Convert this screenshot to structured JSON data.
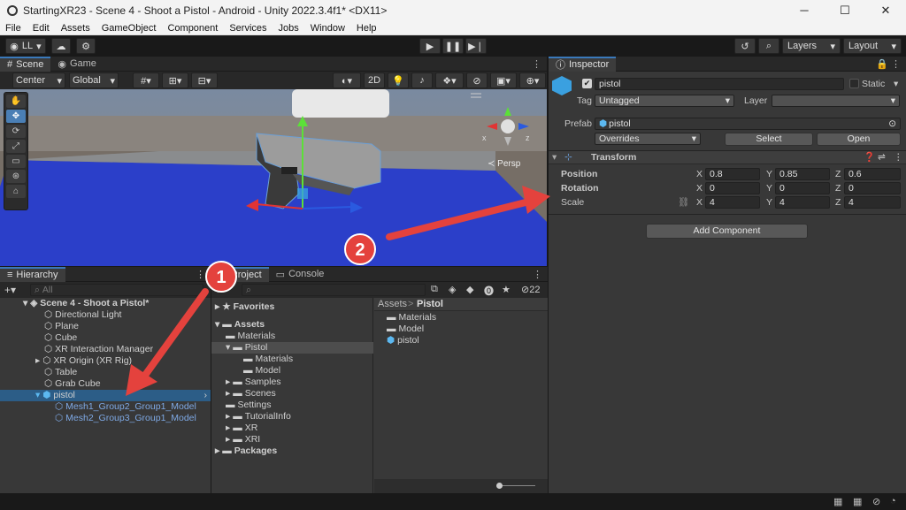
{
  "window": {
    "title": "StartingXR23 - Scene 4 - Shoot a Pistol - Android - Unity 2022.3.4f1* <DX11>",
    "min": "─",
    "max": "☐",
    "close": "✕"
  },
  "menu": [
    "File",
    "Edit",
    "Assets",
    "GameObject",
    "Component",
    "Services",
    "Jobs",
    "Window",
    "Help"
  ],
  "toolbar": {
    "account": "LL",
    "layers": "Layers",
    "layout": "Layout"
  },
  "scene": {
    "tab_scene": "Scene",
    "tab_game": "Game",
    "pivot": "Center",
    "space": "Global",
    "mode2d": "2D",
    "persp": "≺ Persp"
  },
  "hierarchy": {
    "tab": "Hierarchy",
    "search_placeholder": "All",
    "scene_name": "Scene 4 - Shoot a Pistol*",
    "items": [
      "Directional Light",
      "Plane",
      "Cube",
      "XR Interaction Manager",
      "XR Origin (XR Rig)",
      "Table",
      "Grab Cube",
      "pistol",
      "Mesh1_Group2_Group1_Model",
      "Mesh2_Group3_Group1_Model"
    ]
  },
  "project": {
    "tab_project": "Project",
    "tab_console": "Console",
    "hidden_count": "22",
    "favorites": "Favorites",
    "assets": "Assets",
    "tree": [
      "Materials",
      "Pistol",
      "Materials",
      "Model",
      "Samples",
      "Scenes",
      "Settings",
      "TutorialInfo",
      "XR",
      "XRI"
    ],
    "packages": "Packages",
    "breadcrumb_root": "Assets",
    "breadcrumb_sep": ">",
    "breadcrumb_current": "Pistol",
    "files": [
      "Materials",
      "Model",
      "pistol"
    ]
  },
  "inspector": {
    "tab": "Inspector",
    "object_name": "pistol",
    "static_label": "Static",
    "tag_label": "Tag",
    "tag_value": "Untagged",
    "layer_label": "Layer",
    "layer_value": "",
    "prefab_label": "Prefab",
    "prefab_value": "pistol",
    "overrides": "Overrides",
    "select": "Select",
    "open": "Open",
    "transform_title": "Transform",
    "position_label": "Position",
    "rotation_label": "Rotation",
    "scale_label": "Scale",
    "position": {
      "x": "0.8",
      "y": "0.85",
      "z": "0.6"
    },
    "rotation": {
      "x": "0",
      "y": "0",
      "z": "0"
    },
    "scale": {
      "x": "4",
      "y": "4",
      "z": "4"
    },
    "add_component": "Add Component"
  },
  "callouts": [
    "1",
    "2"
  ],
  "colors": {
    "selection": "#2c5d87",
    "callout": "#e4423d",
    "ground": "#2b3fc9",
    "accent": "#3a79bb"
  }
}
